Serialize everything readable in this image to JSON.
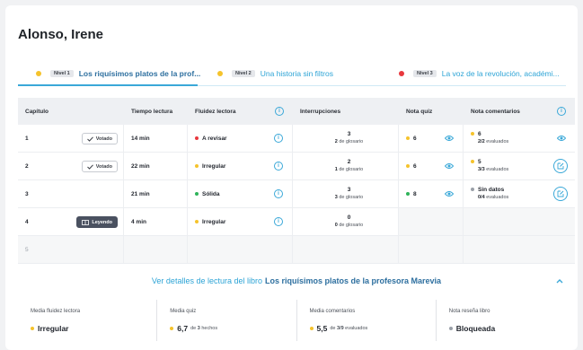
{
  "student": {
    "name": "Alonso, Irene"
  },
  "tabs": [
    {
      "level": "Nivel 1",
      "title": "Los riquísimos platos de la prof...",
      "dot_color": "#f5c32c",
      "active": true
    },
    {
      "level": "Nivel 2",
      "title": "Una historia sin filtros",
      "dot_color": "#f5c32c",
      "active": false
    },
    {
      "level": "Nivel 3",
      "title": "La voz de la revolución, académi...",
      "dot_color": "#e8383d",
      "active": false
    }
  ],
  "table": {
    "headers": {
      "chapter": "Capítulo",
      "reading_time": "Tiempo lectura",
      "fluency": "Fluidez lectora",
      "interruptions": "Interrupciones",
      "quiz": "Nota quiz",
      "comments": "Nota comentarios"
    },
    "rows": [
      {
        "chapter": "1",
        "status": "Votado",
        "time": "14 min",
        "fluency": "A revisar",
        "fluency_color": "#e8383d",
        "int_count": "3",
        "int_num": "2",
        "int_label": "de glosario",
        "quiz": "6",
        "quiz_color": "#f5c32c",
        "comment": "6",
        "comment_color": "#f5c32c",
        "comment_sub_val": "2/2",
        "comment_sub": "evaluados"
      },
      {
        "chapter": "2",
        "status": "Votado",
        "time": "22 min",
        "fluency": "Irregular",
        "fluency_color": "#f5c32c",
        "int_count": "2",
        "int_num": "1",
        "int_label": "de glosario",
        "quiz": "6",
        "quiz_color": "#f5c32c",
        "comment": "5",
        "comment_color": "#f5c32c",
        "comment_sub_val": "3/3",
        "comment_sub": "evaluados"
      },
      {
        "chapter": "3",
        "status": "",
        "time": "21 min",
        "fluency": "Sólida",
        "fluency_color": "#2fb35a",
        "int_count": "3",
        "int_num": "3",
        "int_label": "de glosario",
        "quiz": "8",
        "quiz_color": "#2fb35a",
        "comment": "Sin datos",
        "comment_color": "#9aa0a8",
        "comment_sub_val": "0/4",
        "comment_sub": "evaluados"
      },
      {
        "chapter": "4",
        "status": "Leyendo",
        "time": "4 min",
        "fluency": "Irregular",
        "fluency_color": "#f5c32c",
        "int_count": "0",
        "int_num": "0",
        "int_label": "de glosario"
      },
      {
        "chapter": "5"
      }
    ]
  },
  "details": {
    "prefix": "Ver detalles de lectura del libro",
    "book": "Los riquísimos platos de la profesora Marevia"
  },
  "summary": [
    {
      "label": "Media fluidez lectora",
      "value": "Irregular",
      "color": "#f5c32c"
    },
    {
      "label": "Media quiz",
      "value": "6,7",
      "extra_pre": "de",
      "extra_num": "3",
      "extra_post": "hechos",
      "color": "#f5c32c"
    },
    {
      "label": "Media comentarios",
      "value": "5,5",
      "extra_pre": "de",
      "extra_num": "3/9",
      "extra_post": "evaluados",
      "color": "#f5c32c"
    },
    {
      "label": "Nota reseña libro",
      "value": "Bloqueada",
      "color": "#9aa0a8"
    }
  ]
}
